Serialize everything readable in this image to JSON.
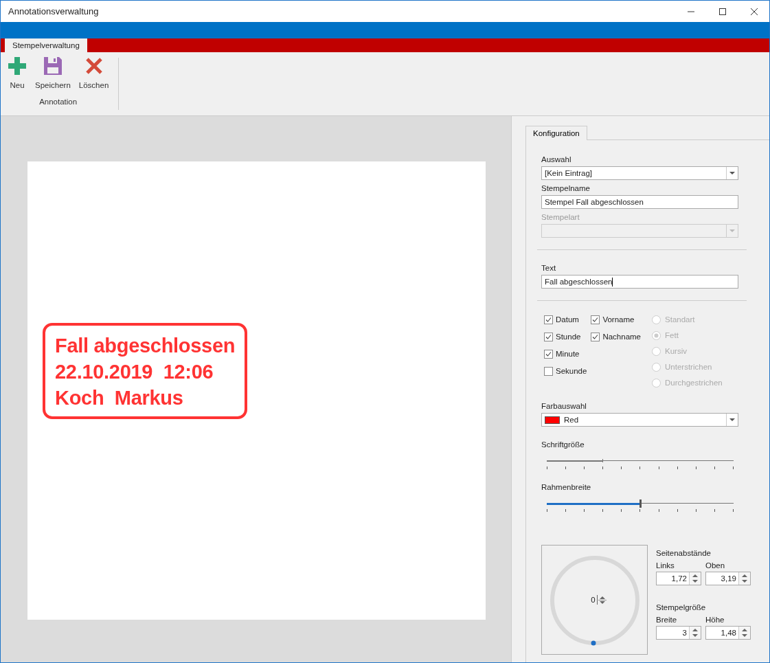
{
  "window": {
    "title": "Annotationsverwaltung"
  },
  "ribbon": {
    "tabs": [
      {
        "label": "Stempelverwaltung",
        "selected": true
      }
    ],
    "buttons": [
      {
        "label": "Neu",
        "kind": "add"
      },
      {
        "label": "Speichern",
        "kind": "save"
      },
      {
        "label": "Löschen",
        "kind": "delete"
      }
    ],
    "group_label": "Annotation"
  },
  "canvas": {
    "stamp": {
      "color": "#ff3333",
      "lines": [
        "Fall abgeschlossen",
        "22.10.2019  12:06",
        "Koch  Markus"
      ]
    }
  },
  "panel": {
    "tabs": [
      {
        "label": "Konfiguration",
        "selected": true
      }
    ],
    "fields": [
      {
        "label": "Auswahl",
        "kind": "select",
        "value": "[Kein Eintrag]",
        "disabled": false
      },
      {
        "label": "Stempelname",
        "kind": "text",
        "value": "Stempel Fall abgeschlossen",
        "disabled": false
      },
      {
        "label": "Stempelart",
        "kind": "select",
        "disabled": true
      }
    ],
    "text_field": {
      "label": "Text",
      "value": "Fall abgeschlossen"
    },
    "checkbox_columns": [
      [
        {
          "label": "Datum",
          "checked": true
        },
        {
          "label": "Stunde",
          "checked": true
        },
        {
          "label": "Minute",
          "checked": true
        },
        {
          "label": "Sekunde",
          "checked": false
        }
      ],
      [
        {
          "label": "Vorname",
          "checked": true
        },
        {
          "label": "Nachname",
          "checked": true
        }
      ]
    ],
    "radios": [
      {
        "label": "Standart",
        "selected": false,
        "disabled": true
      },
      {
        "label": "Fett",
        "selected": true,
        "disabled": true
      },
      {
        "label": "Kursiv",
        "selected": false,
        "disabled": true
      },
      {
        "label": "Unterstrichen",
        "selected": false,
        "disabled": true
      },
      {
        "label": "Durchgestrichen",
        "selected": false,
        "disabled": true
      }
    ],
    "color_select": {
      "label": "Farbauswahl",
      "value": "Red",
      "color": "#ff0000"
    },
    "sliders": [
      {
        "label": "Schriftgröße",
        "level": 0.3,
        "disabled": true
      },
      {
        "label": "Rahmenbreite",
        "level": 0.5,
        "disabled": false
      }
    ],
    "rotation": {
      "value": "0"
    },
    "margins": {
      "title": "Seitenabstände",
      "fields": [
        {
          "label": "Links",
          "value": "1,72"
        },
        {
          "label": "Oben",
          "value": "3,19"
        }
      ]
    },
    "size": {
      "title": "Stempelgröße",
      "fields": [
        {
          "label": "Breite",
          "value": "3"
        },
        {
          "label": "Höhe",
          "value": "1,48"
        }
      ]
    }
  }
}
